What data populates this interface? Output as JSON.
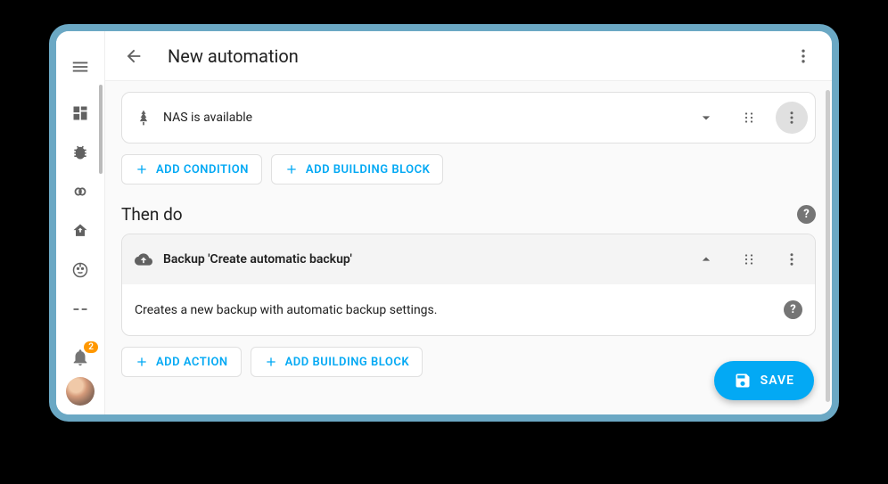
{
  "header": {
    "title": "New automation"
  },
  "trigger_card": {
    "label": "NAS is available"
  },
  "buttons": {
    "add_condition": "ADD CONDITION",
    "add_building_block_1": "ADD BUILDING BLOCK",
    "add_action": "ADD ACTION",
    "add_building_block_2": "ADD BUILDING BLOCK",
    "save": "SAVE"
  },
  "then_section": {
    "title": "Then do"
  },
  "action_panel": {
    "title": "Backup 'Create automatic backup'",
    "description": "Creates a new backup with automatic backup settings."
  },
  "notifications": {
    "count": "2"
  }
}
